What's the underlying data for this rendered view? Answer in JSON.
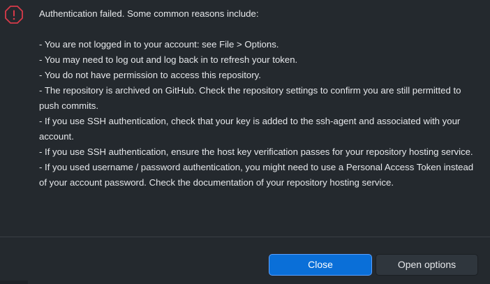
{
  "dialog": {
    "icon": "error-octagon-icon",
    "heading": "Authentication failed. Some common reasons include:",
    "reasons": [
      "- You are not logged in to your account: see File > Options.",
      "- You may need to log out and log back in to refresh your token.",
      "- You do not have permission to access this repository.",
      "- The repository is archived on GitHub. Check the repository settings to confirm you are still permitted to push commits.",
      "- If you use SSH authentication, check that your key is added to the ssh-agent and associated with your account.",
      "- If you use SSH authentication, ensure the host key verification passes for your repository hosting service.",
      "- If you used username / password authentication, you might need to use a Personal Access Token instead of your account password. Check the documentation of your repository hosting service."
    ]
  },
  "buttons": {
    "close_label": "Close",
    "open_options_label": "Open options"
  },
  "colors": {
    "background": "#24292e",
    "primary_button": "#0a6fd8",
    "secondary_button": "#2f363d",
    "error_icon": "#d73a49"
  }
}
